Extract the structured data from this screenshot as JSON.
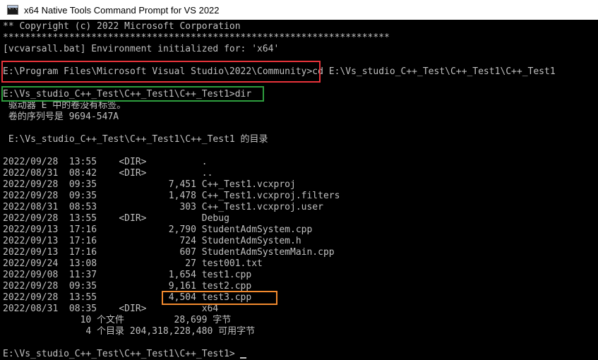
{
  "window": {
    "title": "x64 Native Tools Command Prompt for VS 2022",
    "icon": "cmd-icon"
  },
  "console": {
    "lines": [
      "** Copyright (c) 2022 Microsoft Corporation",
      "**********************************************************************",
      "[vcvarsall.bat] Environment initialized for: 'x64'",
      "",
      "E:\\Program Files\\Microsoft Visual Studio\\2022\\Community>cd E:\\Vs_studio_C++_Test\\C++_Test1\\C++_Test1",
      "",
      "E:\\Vs_studio_C++_Test\\C++_Test1\\C++_Test1>dir",
      " 驱动器 E 中的卷没有标签。",
      " 卷的序列号是 9694-547A",
      "",
      " E:\\Vs_studio_C++_Test\\C++_Test1\\C++_Test1 的目录",
      "",
      "2022/09/28  13:55    <DIR>          .",
      "2022/08/31  08:42    <DIR>          ..",
      "2022/09/28  09:35             7,451 C++_Test1.vcxproj",
      "2022/09/28  09:35             1,478 C++_Test1.vcxproj.filters",
      "2022/08/31  08:53               303 C++_Test1.vcxproj.user",
      "2022/09/28  13:55    <DIR>          Debug",
      "2022/09/13  17:16             2,790 StudentAdmSystem.cpp",
      "2022/09/13  17:16               724 StudentAdmSystem.h",
      "2022/09/13  17:16               607 StudentAdmSystemMain.cpp",
      "2022/09/24  13:08                27 test001.txt",
      "2022/09/08  11:37             1,654 test1.cpp",
      "2022/09/28  09:35             9,161 test2.cpp",
      "2022/09/28  13:55             4,504 test3.cpp",
      "2022/08/31  08:35    <DIR>          x64",
      "              10 个文件         28,699 字节",
      "               4 个目录 204,318,228,480 可用字节",
      "",
      "E:\\Vs_studio_C++_Test\\C++_Test1\\C++_Test1>"
    ]
  },
  "annotations": {
    "red_box_color": "#e8333a",
    "green_box_color": "#2e9e3e",
    "orange_box_color": "#f28a2e"
  }
}
